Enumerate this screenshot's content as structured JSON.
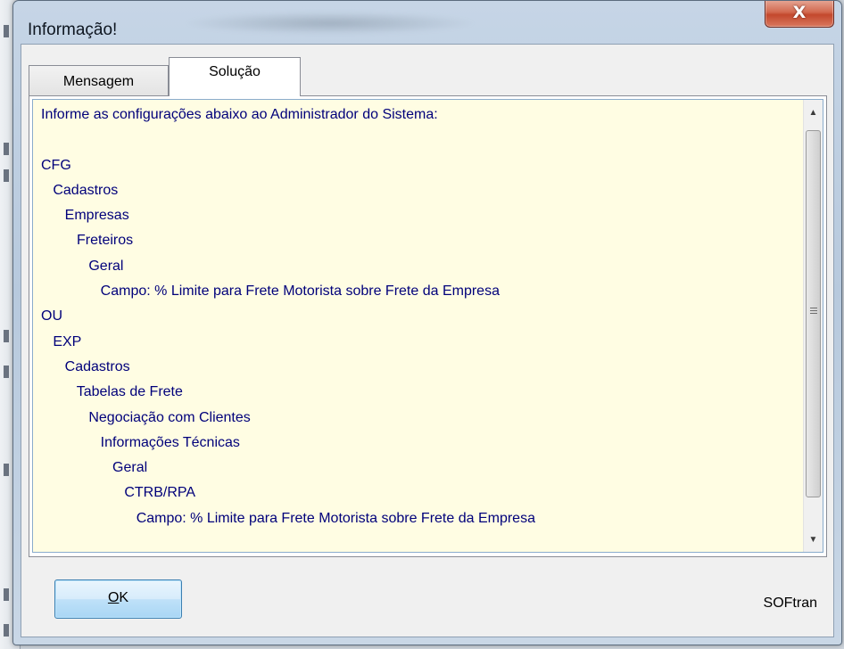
{
  "window": {
    "title": "Informação!",
    "close_label": "X"
  },
  "tabs": [
    {
      "label": "Mensagem",
      "selected": false
    },
    {
      "label": "Solução",
      "selected": true
    }
  ],
  "solution": {
    "lines": [
      "Informe as configurações abaixo ao Administrador do Sistema:",
      "",
      "CFG",
      "   Cadastros",
      "      Empresas",
      "         Freteiros",
      "            Geral",
      "               Campo: % Limite para Frete Motorista sobre Frete da Empresa",
      "OU",
      "   EXP",
      "      Cadastros",
      "         Tabelas de Frete",
      "            Negociação com Clientes",
      "               Informações Técnicas",
      "                  Geral",
      "                     CTRB/RPA",
      "                        Campo: % Limite para Frete Motorista sobre Frete da Empresa"
    ]
  },
  "buttons": {
    "ok_accel": "O",
    "ok_rest": "K"
  },
  "footer": {
    "brand": "SOFtran"
  },
  "colors": {
    "text_blue": "#00007a",
    "textarea_bg": "#fffde3",
    "close_red": "#c3482d"
  }
}
